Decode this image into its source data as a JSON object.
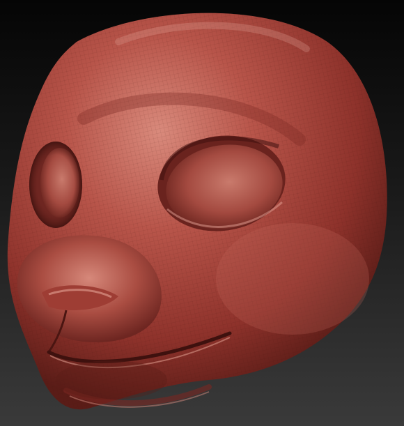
{
  "scene": {
    "background_top": "#050505",
    "background_bottom": "#3a3a3a",
    "clay_color": "#a8433a",
    "clay_highlight": "#d98a7c",
    "clay_shadow": "#5a1c17",
    "wireframe_visible": true,
    "subject": "sculpted-animal-head"
  }
}
